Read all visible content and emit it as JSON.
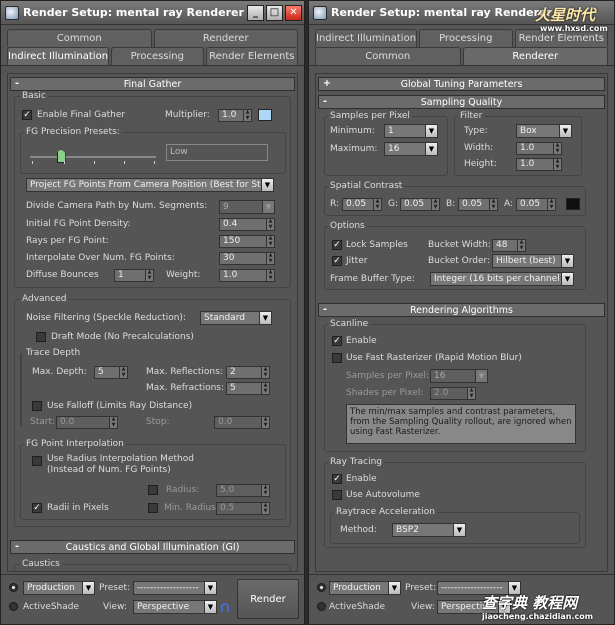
{
  "left": {
    "title": "Render Setup: mental ray Renderer",
    "tabs_row1": [
      "Common",
      "Renderer"
    ],
    "tabs_row2": [
      "Indirect Illumination",
      "Processing",
      "Render Elements"
    ],
    "active_tab": "Indirect Illumination",
    "final_gather": {
      "header": "Final Gather",
      "basic_label": "Basic",
      "enable_label": "Enable Final Gather",
      "enable_checked": true,
      "multiplier_label": "Multiplier:",
      "multiplier_value": "1.0",
      "multiplier_color": "#aed6f5",
      "presets_label": "FG Precision Presets:",
      "preset_value": "Low",
      "preset_level": 0.25,
      "projection_mode": "Project FG Points From Camera Position (Best for Stills)",
      "divide_label": "Divide Camera Path by Num. Segments:",
      "divide_value": "9",
      "density_label": "Initial FG Point Density:",
      "density_value": "0.4",
      "rays_label": "Rays per FG Point:",
      "rays_value": "150",
      "interp_label": "Interpolate Over Num. FG Points:",
      "interp_value": "30",
      "bounces_label": "Diffuse Bounces",
      "bounces_value": "1",
      "weight_label": "Weight:",
      "weight_value": "1.0"
    },
    "advanced": {
      "label": "Advanced",
      "noise_label": "Noise Filtering (Speckle Reduction):",
      "noise_value": "Standard",
      "draft_label": "Draft Mode (No Precalculations)",
      "trace_label": "Trace Depth",
      "max_depth_label": "Max. Depth:",
      "max_depth_value": "5",
      "max_refl_label": "Max. Reflections:",
      "max_refl_value": "2",
      "max_refr_label": "Max. Refractions:",
      "max_refr_value": "5",
      "falloff_label": "Use Falloff (Limits Ray Distance)",
      "start_label": "Start:",
      "start_value": "0.0",
      "stop_label": "Stop:",
      "stop_value": "0.0",
      "fg_interp_label": "FG Point Interpolation",
      "radius_interp_label": "Use Radius Interpolation Method",
      "radius_interp_label2": "(Instead of Num. FG Points)",
      "radius_label": "Radius:",
      "radius_value": "5.0",
      "radii_pixels_label": "Radii in Pixels",
      "radii_pixels_checked": true,
      "min_radius_label": "Min. Radius:",
      "min_radius_value": "0.5"
    },
    "caustics_header": "Caustics and Global Illumination (GI)",
    "caustics_label": "Caustics"
  },
  "right": {
    "title": "Render Setup: mental ray Renderer",
    "tabs_row1": [
      "Indirect Illumination",
      "Processing",
      "Render Elements"
    ],
    "tabs_row2": [
      "Common",
      "Renderer"
    ],
    "active_tab": "Renderer",
    "global_header": "Global Tuning Parameters",
    "sampling_header": "Sampling Quality",
    "samples_label": "Samples per Pixel",
    "minimum_label": "Minimum:",
    "minimum_value": "1",
    "maximum_label": "Maximum:",
    "maximum_value": "16",
    "filter_label": "Filter",
    "type_label": "Type:",
    "type_value": "Box",
    "width_label": "Width:",
    "width_value": "1.0",
    "height_label": "Height:",
    "height_value": "1.0",
    "contrast_label": "Spatial Contrast",
    "r_label": "R:",
    "r_value": "0.05",
    "g_label": "G:",
    "g_value": "0.05",
    "b_label": "B:",
    "b_value": "0.05",
    "a_label": "A:",
    "a_value": "0.05",
    "contrast_color": "#101010",
    "options_label": "Options",
    "lock_label": "Lock Samples",
    "jitter_label": "Jitter",
    "bucket_width_label": "Bucket Width:",
    "bucket_width_value": "48",
    "bucket_order_label": "Bucket Order:",
    "bucket_order_value": "Hilbert (best)",
    "fb_label": "Frame Buffer Type:",
    "fb_value": "Integer (16 bits per channel)",
    "algorithms_header": "Rendering Algorithms",
    "scanline_label": "Scanline",
    "scan_enable_label": "Enable",
    "fast_rast_label": "Use Fast Rasterizer (Rapid Motion Blur)",
    "spp_label": "Samples per Pixel:",
    "spp_value": "16",
    "shades_label": "Shades per Pixel:",
    "shades_value": "2.0",
    "note": "The min/max samples and contrast parameters, from the Sampling Quality rollout, are ignored when using Fast Rasterizer.",
    "raytracing_label": "Ray Tracing",
    "rt_enable_label": "Enable",
    "autovolume_label": "Use Autovolume",
    "rt_accel_label": "Raytrace Acceleration",
    "method_label": "Method:",
    "method_value": "BSP2"
  },
  "bottom": {
    "production_label": "Production",
    "activeshade_label": "ActiveShade",
    "preset_label": "Preset:",
    "preset_value": "-------------------",
    "view_label": "View:",
    "view_value": "Perspective",
    "render_label": "Render"
  },
  "watermarks": {
    "top": "火星时代",
    "top_url": "www.hxsd.com",
    "bottom": "查字典 教程网",
    "bottom_url": "jiaocheng.chazidian.com"
  }
}
